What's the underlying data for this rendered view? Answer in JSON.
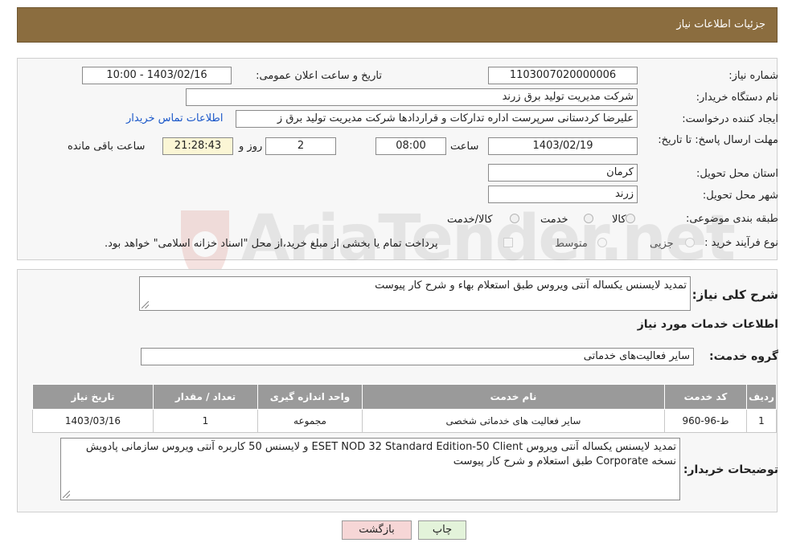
{
  "header": {
    "title": "جزئیات اطلاعات نیاز"
  },
  "fields": {
    "need_number": {
      "label": "شماره نیاز:",
      "value": "1103007020000006"
    },
    "announce_datetime": {
      "label": "تاریخ و ساعت اعلان عمومی:",
      "value": "1403/02/16 - 10:00"
    },
    "buyer_org": {
      "label": "نام دستگاه خریدار:",
      "value": "شرکت مدیریت تولید برق زرند"
    },
    "requester": {
      "label": "ایجاد کننده درخواست:",
      "value": "علیرضا کردستانی سرپرست اداره تدارکات و قراردادها شرکت مدیریت تولید برق ز",
      "contact_link": "اطلاعات تماس خریدار"
    },
    "deadline": {
      "label": "مهلت ارسال پاسخ: تا تاریخ:",
      "date": "1403/02/19",
      "time_label": "ساعت",
      "time": "08:00",
      "days": "2",
      "days_label": "روز و",
      "remaining": "21:28:43",
      "remaining_label": "ساعت باقی مانده"
    },
    "province": {
      "label": "استان محل تحویل:",
      "value": "کرمان"
    },
    "city": {
      "label": "شهر محل تحویل:",
      "value": "زرند"
    },
    "category": {
      "label": "طبقه بندی موضوعی:",
      "options": [
        "کالا",
        "خدمت",
        "کالا/خدمت"
      ]
    },
    "purchase_type": {
      "label": "نوع فرآیند خرید :",
      "options": [
        "جزیی",
        "متوسط"
      ],
      "note": "پرداخت تمام یا بخشی از مبلغ خرید،از محل \"اسناد خزانه اسلامی\" خواهد بود."
    }
  },
  "summary": {
    "label": "شرح کلی نیاز:",
    "value": "تمدید لایسنس یکساله آنتی ویروس طبق استعلام بهاء و شرح کار پیوست"
  },
  "services": {
    "section_title": "اطلاعات خدمات مورد نیاز",
    "group_label": "گروه خدمت:",
    "group_value": "سایر فعالیت‌های خدماتی",
    "table": {
      "headers": [
        "ردیف",
        "کد خدمت",
        "نام خدمت",
        "واحد اندازه گیری",
        "تعداد / مقدار",
        "تاریخ نیاز"
      ],
      "rows": [
        [
          "1",
          "ط-96-960",
          "سایر فعالیت های خدماتی شخصی",
          "مجموعه",
          "1",
          "1403/03/16"
        ]
      ]
    }
  },
  "buyer_notes": {
    "label": "توضیحات خریدار:",
    "value": "تمدید لایسنس یکساله آنتی ویروس ESET NOD 32 Standard Edition-50 Client و لایسنس 50 کاربره آنتی ویروس سازمانی پادویش نسخه Corporate طبق استعلام و شرح کار پیوست"
  },
  "buttons": {
    "print": "چاپ",
    "back": "بازگشت"
  },
  "watermark": {
    "text": "AriaTender.net"
  },
  "colors": {
    "header_bg": "#8b6d3f",
    "link": "#1a57c9",
    "table_header": "#9a9a9a",
    "back_button": "#f6d6d6",
    "print_button": "#e3f3da"
  }
}
